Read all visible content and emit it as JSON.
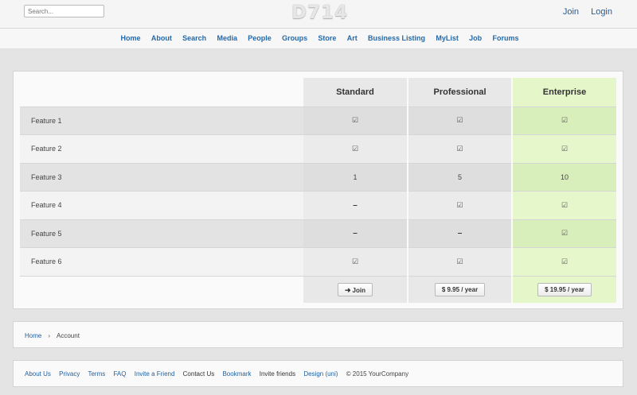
{
  "header": {
    "search_placeholder": "Search...",
    "logo": "D714",
    "join": "Join",
    "login": "Login"
  },
  "nav": [
    "Home",
    "About",
    "Search",
    "Media",
    "People",
    "Groups",
    "Store",
    "Art",
    "Business Listing",
    "MyList",
    "Job",
    "Forums"
  ],
  "pricing": {
    "plans": [
      "Standard",
      "Professional",
      "Enterprise"
    ],
    "features": [
      {
        "name": "Feature 1",
        "values": [
          "check",
          "check",
          "check"
        ]
      },
      {
        "name": "Feature 2",
        "values": [
          "check",
          "check",
          "check"
        ]
      },
      {
        "name": "Feature 3",
        "values": [
          "1",
          "5",
          "10"
        ]
      },
      {
        "name": "Feature 4",
        "values": [
          "dash",
          "check",
          "check"
        ]
      },
      {
        "name": "Feature 5",
        "values": [
          "dash",
          "dash",
          "check"
        ]
      },
      {
        "name": "Feature 6",
        "values": [
          "check",
          "check",
          "check"
        ]
      }
    ],
    "buttons": [
      "Join",
      "$ 9.95 / year",
      "$ 19.95 / year"
    ],
    "check_glyph": "☑",
    "dash_glyph": "–",
    "join_icon": "sign-in-icon",
    "colors": {
      "enterprise": "#e5f6c9",
      "link": "#2568a8"
    }
  },
  "breadcrumb": {
    "home": "Home",
    "separator": "›",
    "current": "Account"
  },
  "footer": {
    "links": [
      "About Us",
      "Privacy",
      "Terms",
      "FAQ",
      "Invite a Friend",
      "Contact Us",
      "Bookmark",
      "Invite friends",
      "Design (uni)"
    ],
    "copyright": "© 2015 YourCompany"
  }
}
